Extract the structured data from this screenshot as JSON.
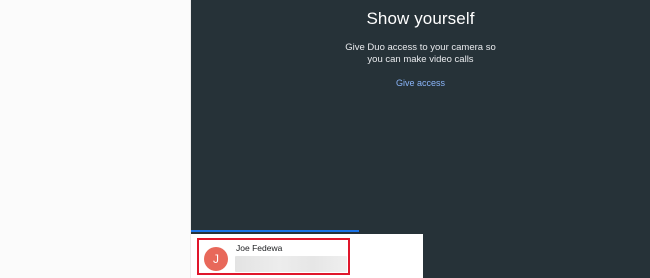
{
  "camera_prompt": {
    "title": "Show yourself",
    "description_line1": "Give Duo access to your camera so",
    "description_line2": "you can make video calls",
    "access_link": "Give access"
  },
  "contact": {
    "name": "Joe Fedewa",
    "avatar_initial": "J",
    "avatar_color": "#e8685a"
  },
  "colors": {
    "panel_background": "#263238",
    "link": "#8ab4f8",
    "highlight_box": "#e0162b",
    "progress": "#1a73e8"
  }
}
